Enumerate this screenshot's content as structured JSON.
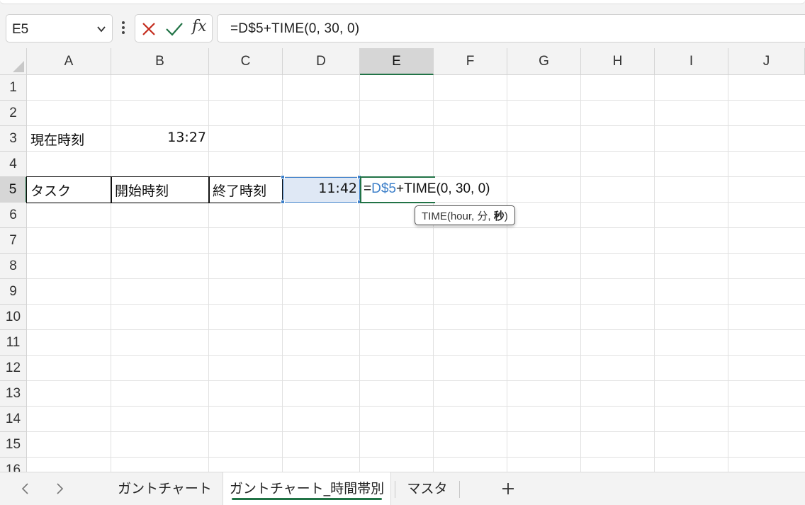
{
  "name_box": {
    "value": "E5"
  },
  "formula_bar": {
    "fx_label": "fx",
    "formula": "=D$5+TIME(0, 30, 0)"
  },
  "columns": [
    "A",
    "B",
    "C",
    "D",
    "E",
    "F",
    "G",
    "H",
    "I",
    "J"
  ],
  "rows": [
    "1",
    "2",
    "3",
    "4",
    "5",
    "6",
    "7",
    "8",
    "9",
    "10",
    "11",
    "12",
    "13",
    "14",
    "15",
    "16"
  ],
  "selected_column": "E",
  "selected_row": "5",
  "cells": {
    "A3": "現在時刻",
    "B3": "13:27",
    "A5": "タスク",
    "B5": "開始時刻",
    "C5": "終了時刻",
    "D5": "11:42"
  },
  "edit_cell": {
    "prefix": "=",
    "ref": "D$5",
    "rest": "+TIME(0, 30, 0)"
  },
  "tooltip": {
    "func": "TIME(hour, 分, ",
    "bold_arg": "秒",
    "close": ")"
  },
  "sheet_tabs": [
    {
      "label": "ガントチャート",
      "active": false
    },
    {
      "label": "ガントチャート_時間帯別",
      "active": true
    },
    {
      "label": "マスタ",
      "active": false
    }
  ],
  "colors": {
    "accent_green": "#217346",
    "ref_blue": "#3c7fc9",
    "cancel_red": "#c42b1c"
  }
}
